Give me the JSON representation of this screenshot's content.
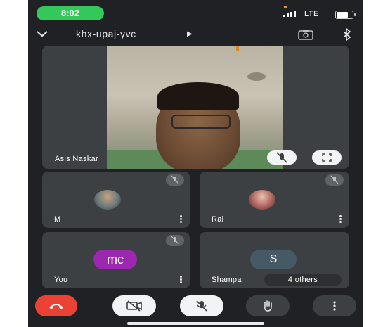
{
  "status_bar": {
    "time": "8:02",
    "network": "LTE"
  },
  "header": {
    "meeting_code": "khx-upaj-yvc"
  },
  "main_tile": {
    "name": "Asis Naskar"
  },
  "tiles": [
    {
      "name": "M"
    },
    {
      "name": "Rai"
    },
    {
      "name": "You",
      "initials": "mc"
    },
    {
      "name": "Shampa",
      "initials": "S",
      "others_label": "4 others"
    }
  ],
  "icons": [
    "chevron-down-icon",
    "arrow-right-icon",
    "camera-switch-icon",
    "bluetooth-icon",
    "mic-off-icon",
    "fullscreen-icon",
    "more-vert-icon",
    "end-call-icon",
    "camera-off-icon",
    "raise-hand-icon"
  ],
  "colors": {
    "end_call": "#ea4335",
    "you_avatar": "#9c27b0",
    "shampa_avatar": "#455a64",
    "time_pill": "#34c759"
  }
}
